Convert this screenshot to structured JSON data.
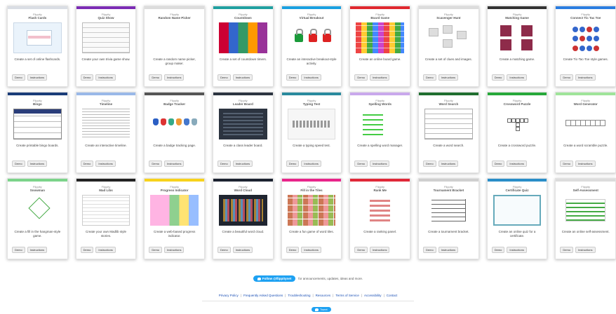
{
  "cards": [
    [
      {
        "brand": "Flippity",
        "title": "Flash Cards",
        "desc": "Create a set of online flashcards.",
        "bar": "#d9dde4",
        "thumb": "clock"
      },
      {
        "brand": "Flippity",
        "title": "Quiz Show",
        "desc": "Create your own trivia game show.",
        "bar": "#7b2bb4",
        "thumb": "grid"
      },
      {
        "brand": "Flippity",
        "title": "Random Name Picker",
        "desc": "Create a random name picker, group maker.",
        "bar": "#dcdcdc",
        "thumb": "wheel"
      },
      {
        "brand": "Flippity",
        "title": "Countdown",
        "desc": "Create a set of countdown timers.",
        "bar": "#20a0a0",
        "thumb": "count"
      },
      {
        "brand": "Flippity",
        "title": "Virtual Breakout",
        "desc": "Create an interactive breakout-style activity.",
        "bar": "#1aa0e0",
        "thumb": "lock"
      },
      {
        "brand": "Flippity",
        "title": "Board Game",
        "desc": "Create an online board game.",
        "bar": "#e0282e",
        "thumb": "board"
      },
      {
        "brand": "Flippity",
        "title": "Scavenger Hunt",
        "desc": "Create a set of clues and images.",
        "bar": "#dcdcdc",
        "thumb": "sort"
      },
      {
        "brand": "Flippity",
        "title": "Matching Game",
        "desc": "Create a matching game.",
        "bar": "#333333",
        "thumb": "mem"
      },
      {
        "brand": "Flippity",
        "title": "Connect Tic Tac Toe",
        "desc": "Create Tic-Tac-Toe style games.",
        "bar": "#2a7de0",
        "thumb": "ttt"
      }
    ],
    [
      {
        "brand": "Flippity",
        "title": "Bingo",
        "desc": "Create printable bingo boards.",
        "bar": "#1a3c78",
        "thumb": "bingo"
      },
      {
        "brand": "Flippity",
        "title": "Timeline",
        "desc": "Create an interactive timeline.",
        "bar": "#9ab8e8",
        "thumb": "lines"
      },
      {
        "brand": "Flippity",
        "title": "Badge Tracker",
        "desc": "Create a badge tracking page.",
        "bar": "#555555",
        "thumb": "badge"
      },
      {
        "brand": "Flippity",
        "title": "Leader Board",
        "desc": "Create a class leader board.",
        "bar": "#2c3440",
        "thumb": "leader"
      },
      {
        "brand": "Flippity",
        "title": "Typing Test",
        "desc": "Create a typing speed test.",
        "bar": "#2a8a9e",
        "thumb": "typing"
      },
      {
        "brand": "Flippity",
        "title": "Spelling Words",
        "desc": "Create a spelling word manager.",
        "bar": "#c9a8ec",
        "thumb": "spell"
      },
      {
        "brand": "Flippity",
        "title": "Word Search",
        "desc": "Create a word search.",
        "bar": "#1f6e2f",
        "thumb": "ws"
      },
      {
        "brand": "Flippity",
        "title": "Crossword Puzzle",
        "desc": "Create a crossword puzzle.",
        "bar": "#27a83a",
        "thumb": "cw"
      },
      {
        "brand": "Flippity",
        "title": "Word Generator",
        "desc": "Create a word scramble puzzle.",
        "bar": "#9fe49a",
        "thumb": "wg"
      }
    ],
    [
      {
        "brand": "Flippity",
        "title": "Snowman",
        "desc": "Create a fill in the hangman-style game.",
        "bar": "#7cd38a",
        "thumb": "snow"
      },
      {
        "brand": "Flippity",
        "title": "Mad Libs",
        "desc": "Create your own Madlib style stories.",
        "bar": "#222222",
        "thumb": "mad"
      },
      {
        "brand": "Flippity",
        "title": "Progress Indicator",
        "desc": "Create a web-based progress indicator.",
        "bar": "#f7d21c",
        "thumb": "pr"
      },
      {
        "brand": "Flippity",
        "title": "Word Cloud",
        "desc": "Create a beautiful word cloud.",
        "bar": "#1c2230",
        "thumb": "cloud"
      },
      {
        "brand": "Flippity",
        "title": "Fill in the Tiles",
        "desc": "Create a fun game of word tiles.",
        "bar": "#e8258a",
        "thumb": "tiles"
      },
      {
        "brand": "Flippity",
        "title": "Rank Me",
        "desc": "Create a ranking panel.",
        "bar": "#e02838",
        "thumb": "rank"
      },
      {
        "brand": "Flippity",
        "title": "Tournament Bracket",
        "desc": "Create a tournament bracket.",
        "bar": "#cfcfcf",
        "thumb": "tour"
      },
      {
        "brand": "Flippity",
        "title": "Certificate Quiz",
        "desc": "Create an online quiz for a certificate.",
        "bar": "#2a8ec8",
        "thumb": "cert"
      },
      {
        "brand": "Flippity",
        "title": "Self-Assessment",
        "desc": "Create an online self-assessment.",
        "bar": "#dcdcdc",
        "thumb": "self"
      }
    ]
  ],
  "buttons": {
    "demo": "Demo",
    "instructions": "Instructions"
  },
  "twitter": {
    "button": "Follow @flippitynet",
    "text": "for announcements, updates, ideas and more."
  },
  "footer": [
    "Privacy Policy",
    "Frequently Asked Questions",
    "Troubleshooting",
    "Resources",
    "Terms of Service",
    "Accessibility",
    "Contact"
  ],
  "tweet": "Tweet"
}
